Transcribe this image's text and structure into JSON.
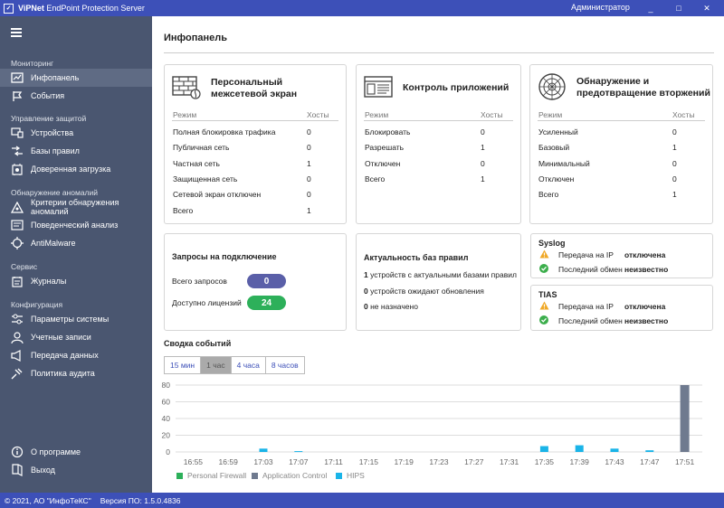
{
  "window": {
    "app_name": "ViPNet",
    "title": "EndPoint Protection Server",
    "user": "Администратор",
    "min": "_",
    "max": "□",
    "close": "✕"
  },
  "sidebar": {
    "sections": [
      {
        "title": "Мониторинг",
        "items": [
          {
            "label": "Инфопанель",
            "icon": "infopanel-icon",
            "active": true
          },
          {
            "label": "События",
            "icon": "flag-icon"
          }
        ]
      },
      {
        "title": "Управление защитой",
        "items": [
          {
            "label": "Устройства",
            "icon": "devices-icon"
          },
          {
            "label": "Базы правил",
            "icon": "rules-icon"
          },
          {
            "label": "Доверенная загрузка",
            "icon": "trusted-boot-icon"
          }
        ]
      },
      {
        "title": "Обнаружение аномалий",
        "items": [
          {
            "label": "Критерии обнаружения аномалий",
            "icon": "anomaly-criteria-icon"
          },
          {
            "label": "Поведенческий анализ",
            "icon": "behavior-icon"
          },
          {
            "label": "AntiMalware",
            "icon": "antimalware-icon"
          }
        ]
      },
      {
        "title": "Сервис",
        "items": [
          {
            "label": "Журналы",
            "icon": "logs-icon"
          }
        ]
      },
      {
        "title": "Конфигурация",
        "items": [
          {
            "label": "Параметры системы",
            "icon": "settings-icon"
          },
          {
            "label": "Учетные записи",
            "icon": "accounts-icon"
          },
          {
            "label": "Передача данных",
            "icon": "data-transfer-icon"
          },
          {
            "label": "Политика аудита",
            "icon": "audit-policy-icon"
          }
        ]
      }
    ],
    "bottom": [
      {
        "label": "О программе",
        "icon": "info-icon"
      },
      {
        "label": "Выход",
        "icon": "exit-icon"
      }
    ]
  },
  "page": {
    "title": "Инфопанель"
  },
  "cards": {
    "firewall": {
      "title": "Персональный межсетевой экран",
      "col_mode": "Режим",
      "col_hosts": "Хосты",
      "rows": [
        {
          "label": "Полная блокировка трафика",
          "value": "0"
        },
        {
          "label": "Публичная сеть",
          "value": "0"
        },
        {
          "label": "Частная сеть",
          "value": "1"
        },
        {
          "label": "Защищенная сеть",
          "value": "0"
        },
        {
          "label": "Сетевой экран отключен",
          "value": "0"
        }
      ],
      "total_label": "Всего",
      "total_value": "1"
    },
    "appcontrol": {
      "title": "Контроль приложений",
      "col_mode": "Режим",
      "col_hosts": "Хосты",
      "rows": [
        {
          "label": "Блокировать",
          "value": "0"
        },
        {
          "label": "Разрешать",
          "value": "1"
        },
        {
          "label": "Отключен",
          "value": "0"
        }
      ],
      "total_label": "Всего",
      "total_value": "1"
    },
    "ids": {
      "title": "Обнаружение и предотвращение вторжений",
      "col_mode": "Режим",
      "col_hosts": "Хосты",
      "rows": [
        {
          "label": "Усиленный",
          "value": "0"
        },
        {
          "label": "Базовый",
          "value": "1"
        },
        {
          "label": "Минимальный",
          "value": "0"
        },
        {
          "label": "Отключен",
          "value": "0"
        }
      ],
      "total_label": "Всего",
      "total_value": "1"
    },
    "requests": {
      "title": "Запросы на подключение",
      "total_label": "Всего запросов",
      "total_value": "0",
      "licenses_label": "Доступно лицензий",
      "licenses_value": "24",
      "total_color": "#5a5fa8",
      "licenses_color": "#2db05a"
    },
    "rules_status": {
      "title": "Актуальность баз правил",
      "lines": [
        {
          "count": "1",
          "text": "устройств с актуальными базами правил"
        },
        {
          "count": "0",
          "text": "устройств ожидают обновления"
        },
        {
          "count": "0",
          "text": "не назначено"
        }
      ]
    },
    "syslog": {
      "title": "Syslog",
      "rows": [
        {
          "icon": "warning-icon",
          "label": "Передача на IP",
          "value": "отключена"
        },
        {
          "icon": "check-icon",
          "label": "Последний обмен",
          "value": "неизвестно"
        }
      ]
    },
    "tias": {
      "title": "TIAS",
      "rows": [
        {
          "icon": "warning-icon",
          "label": "Передача на IP",
          "value": "отключена"
        },
        {
          "icon": "check-icon",
          "label": "Последний обмен",
          "value": "неизвестно"
        }
      ]
    }
  },
  "events": {
    "title": "Сводка событий",
    "tabs": [
      {
        "label": "15 мин"
      },
      {
        "label": "1 час",
        "active": true
      },
      {
        "label": "4 часа"
      },
      {
        "label": "8 часов"
      }
    ]
  },
  "chart_data": {
    "type": "bar",
    "categories": [
      "16:55",
      "16:59",
      "17:03",
      "17:07",
      "17:11",
      "17:15",
      "17:19",
      "17:23",
      "17:27",
      "17:31",
      "17:35",
      "17:39",
      "17:43",
      "17:47",
      "17:51"
    ],
    "series": [
      {
        "name": "Personal Firewall",
        "color": "#2db05a",
        "values": [
          0,
          0,
          0,
          0,
          0,
          0,
          0,
          0,
          0,
          0,
          0,
          0,
          0,
          0,
          0
        ]
      },
      {
        "name": "Application Control",
        "color": "#6f7a8f",
        "values": [
          0,
          0,
          0,
          0,
          0,
          0,
          0,
          0,
          0,
          0,
          0,
          0,
          0,
          0,
          80
        ]
      },
      {
        "name": "HIPS",
        "color": "#1ab4e8",
        "values": [
          0,
          0,
          4,
          1,
          0,
          0,
          0,
          0,
          0,
          0,
          7,
          8,
          4,
          2,
          0
        ]
      }
    ],
    "yticks": [
      "0",
      "20",
      "40",
      "60",
      "80"
    ],
    "ylim": [
      0,
      80
    ],
    "grid": true,
    "legend": "bottom-left"
  },
  "footer": {
    "copyright": "© 2021, АО \"ИнфоТеКС\"",
    "version": "Версия ПО: 1.5.0.4836"
  }
}
